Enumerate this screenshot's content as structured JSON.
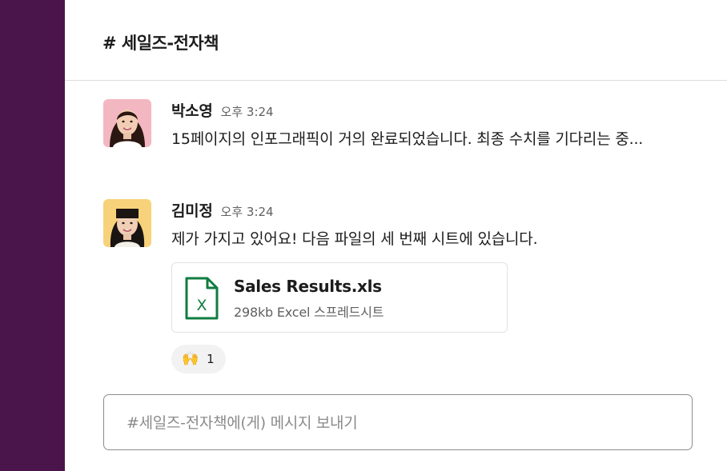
{
  "channel": {
    "title": "# 세일즈-전자책"
  },
  "messages": [
    {
      "sender": "박소영",
      "time": "오후 3:24",
      "text": "15페이지의 인포그래픽이 거의 완료되었습니다. 최종 수치를 기다리는 중..."
    },
    {
      "sender": "김미정",
      "time": "오후 3:24",
      "text": "제가 가지고 있어요! 다음 파일의 세 번째 시트에 있습니다.",
      "attachment": {
        "name": "Sales Results.xls",
        "meta": "298kb Excel 스프레드시트",
        "icon_letter": "X",
        "icon_color": "#107c41"
      },
      "reaction": {
        "emoji": "🙌",
        "count": "1"
      }
    }
  ],
  "composer": {
    "placeholder": "#세일즈-전자책에(게) 메시지 보내기"
  },
  "colors": {
    "sidebar": "#4a154b",
    "excel_green": "#107c41"
  }
}
